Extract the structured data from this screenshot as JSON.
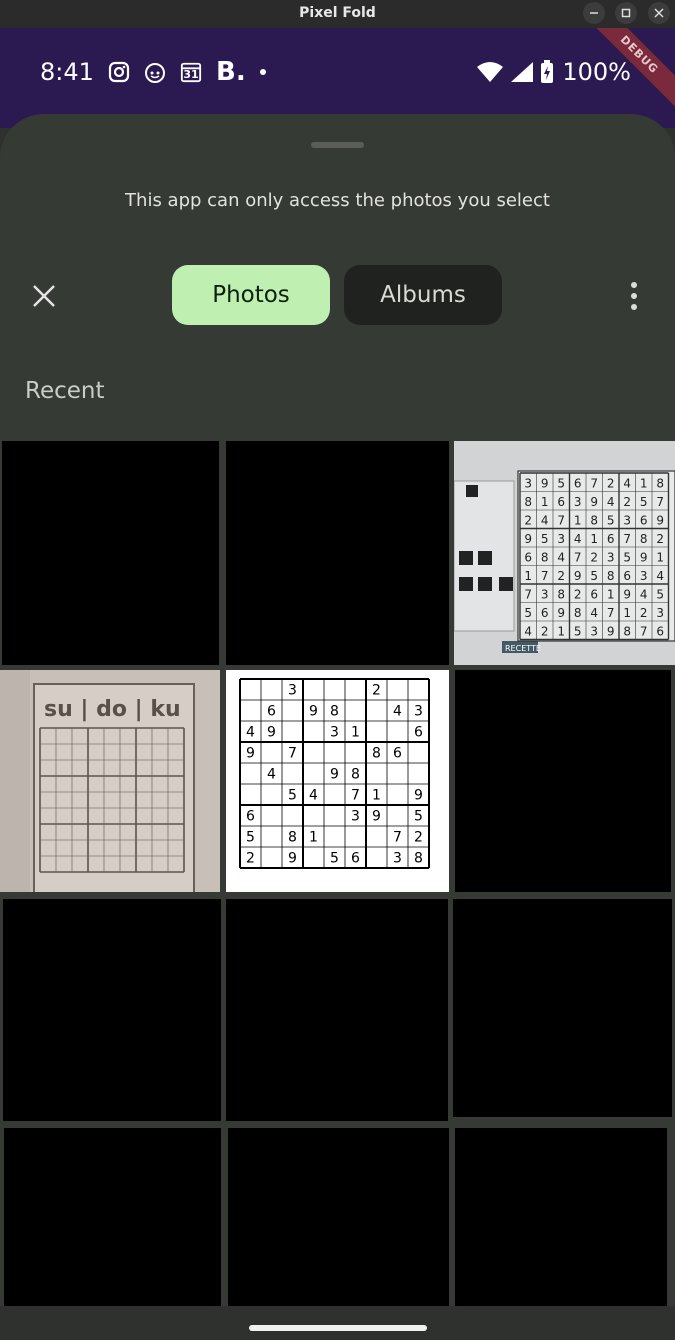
{
  "window": {
    "title": "Pixel Fold"
  },
  "status": {
    "time": "8:41",
    "calendar_day": "31",
    "battery": "100%",
    "debug_label": "DEBUG"
  },
  "sheet": {
    "subtitle": "This app can only access the photos you select",
    "tabs": [
      {
        "label": "Photos",
        "selected": true
      },
      {
        "label": "Albums",
        "selected": false
      }
    ],
    "section_title": "Recent"
  },
  "photos": {
    "sudoku_news_title": "su | do | ku",
    "sudoku_grid": [
      [
        "",
        "",
        "3",
        "",
        "",
        "",
        "2",
        "",
        ""
      ],
      [
        "",
        "6",
        "",
        "9",
        "8",
        "",
        "",
        "4",
        "3"
      ],
      [
        "4",
        "9",
        "",
        "",
        "3",
        "1",
        "",
        "",
        "6"
      ],
      [
        "9",
        "",
        "7",
        "",
        "",
        "",
        "8",
        "6",
        ""
      ],
      [
        "",
        "4",
        "",
        "",
        "9",
        "8",
        "",
        "",
        ""
      ],
      [
        "",
        "",
        "5",
        "4",
        "",
        "7",
        "1",
        "",
        "9"
      ],
      [
        "6",
        "",
        "",
        "",
        "",
        "3",
        "9",
        "",
        "5"
      ],
      [
        "5",
        "",
        "8",
        "1",
        "",
        "",
        "",
        "7",
        "2"
      ],
      [
        "2",
        "",
        "9",
        "",
        "5",
        "6",
        "",
        "3",
        "8"
      ]
    ],
    "clipping_grid": [
      [
        "3",
        "9",
        "5",
        "6",
        "7",
        "2",
        "4",
        "1",
        "8"
      ],
      [
        "8",
        "1",
        "6",
        "3",
        "9",
        "4",
        "2",
        "5",
        "7"
      ],
      [
        "2",
        "4",
        "7",
        "1",
        "8",
        "5",
        "3",
        "6",
        "9"
      ],
      [
        "9",
        "5",
        "3",
        "4",
        "1",
        "6",
        "7",
        "8",
        "2"
      ],
      [
        "6",
        "8",
        "4",
        "7",
        "2",
        "3",
        "5",
        "9",
        "1"
      ],
      [
        "1",
        "7",
        "2",
        "9",
        "5",
        "8",
        "6",
        "3",
        "4"
      ],
      [
        "7",
        "3",
        "8",
        "2",
        "6",
        "1",
        "9",
        "4",
        "5"
      ],
      [
        "5",
        "6",
        "9",
        "8",
        "4",
        "7",
        "1",
        "2",
        "3"
      ],
      [
        "4",
        "2",
        "1",
        "5",
        "3",
        "9",
        "8",
        "7",
        "6"
      ]
    ],
    "clipping_label": "RECETTE"
  }
}
